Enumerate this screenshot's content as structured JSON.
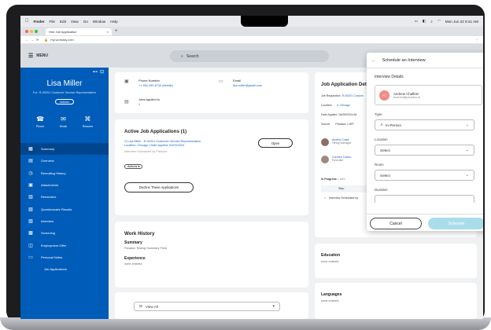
{
  "menubar": {
    "items": [
      "Finder",
      "File",
      "Edit",
      "View",
      "Go",
      "Window",
      "Help"
    ],
    "clock": "Mon Jun 22  8:41 AM"
  },
  "browser": {
    "tab_title": "Hire Job Application",
    "new_tab": "+",
    "close_tab": "×",
    "url": "my.workday.com"
  },
  "header": {
    "menu_label": "MENU",
    "search_placeholder": "Search"
  },
  "profile": {
    "name": "Lisa Miller",
    "role": "For: R-00201 Customer Service Representative",
    "actions_label": "Actions",
    "contact": [
      {
        "label": "Phone",
        "icon": "phone-icon"
      },
      {
        "label": "Email",
        "icon": "email-icon"
      },
      {
        "label": "Resume",
        "icon": "paperclip-icon"
      }
    ]
  },
  "nav": [
    {
      "label": "Summary",
      "icon": "grid-icon",
      "active": true
    },
    {
      "label": "Overview",
      "icon": "document-icon"
    },
    {
      "label": "Recruiting History",
      "icon": "clock-icon"
    },
    {
      "label": "Attachments",
      "icon": "briefcase-icon"
    },
    {
      "label": "Reminders",
      "icon": "calendar-icon"
    },
    {
      "label": "Questionnaire Results",
      "icon": "clipboard-icon"
    },
    {
      "label": "Interview",
      "icon": "people-icon"
    },
    {
      "label": "Screening",
      "icon": "checklist-icon"
    },
    {
      "label": "Employment Offer",
      "icon": "offer-icon"
    },
    {
      "label": "Personal Notes",
      "icon": "notes-icon"
    },
    {
      "label": "Job Applications",
      "icon": "",
      "sub": true
    }
  ],
  "contact_card": {
    "phone_label": "Phone Number",
    "phone_value": "+1 954-290-8734 (Mobile)",
    "email_label": "Email",
    "email_value": "lisa.miller@gmail.com",
    "jobs_label": "Jobs Applied to",
    "jobs_value": "1"
  },
  "applications": {
    "title": "Active Job Applications (1)",
    "job_line": "Lisa Miller - R-00201 Customer Service Representative",
    "location_line": "Location: Chicago | Date Applied: 04/03/2024",
    "status_line": "Interview Scheduled by Paradox",
    "open_label": "Open",
    "actions_label": "Actions",
    "decline_label": "Decline These Applications"
  },
  "work_history": {
    "title": "Work History",
    "summary_label": "Summary",
    "summary_value": "Paradox Testing Summary Field",
    "experience_label": "Experience",
    "experience_value": "none entered"
  },
  "view_all": "View All",
  "job_details": {
    "title": "Job Application Details",
    "rows": [
      {
        "label": "Job Requisition",
        "value": "R-00201 Custom"
      },
      {
        "label": "Location",
        "value": "Chicago"
      },
      {
        "label": "Date Applied",
        "value": "04/09/2024 All"
      },
      {
        "label": "Source",
        "value": "Paradox > API"
      }
    ],
    "people": [
      {
        "name": "Amelia Costa",
        "role": "Hiring Manager"
      },
      {
        "name": "Carmen Castro",
        "role": "Recruiter"
      }
    ],
    "in_progress": "In Progress",
    "in_progress_count": "1 item",
    "table_header": "Step",
    "table_row": "Interview Scheduled by"
  },
  "education": {
    "title": "Education",
    "value": "none entered"
  },
  "languages": {
    "title": "Languages",
    "value": "none entered"
  },
  "dialog": {
    "title": "Schedule an Interview",
    "section": "Interview Details",
    "interviewer": {
      "initials": "AC",
      "name": "Andrew Chalfetz",
      "email": "andrew@paradox.ai"
    },
    "type_label": "Type",
    "type_value": "In-Person",
    "location_label": "Location",
    "location_value": "Select",
    "room_label": "Room",
    "room_value": "Select",
    "duration_label": "Duration",
    "cancel_label": "Cancel",
    "schedule_label": "Schedule"
  }
}
